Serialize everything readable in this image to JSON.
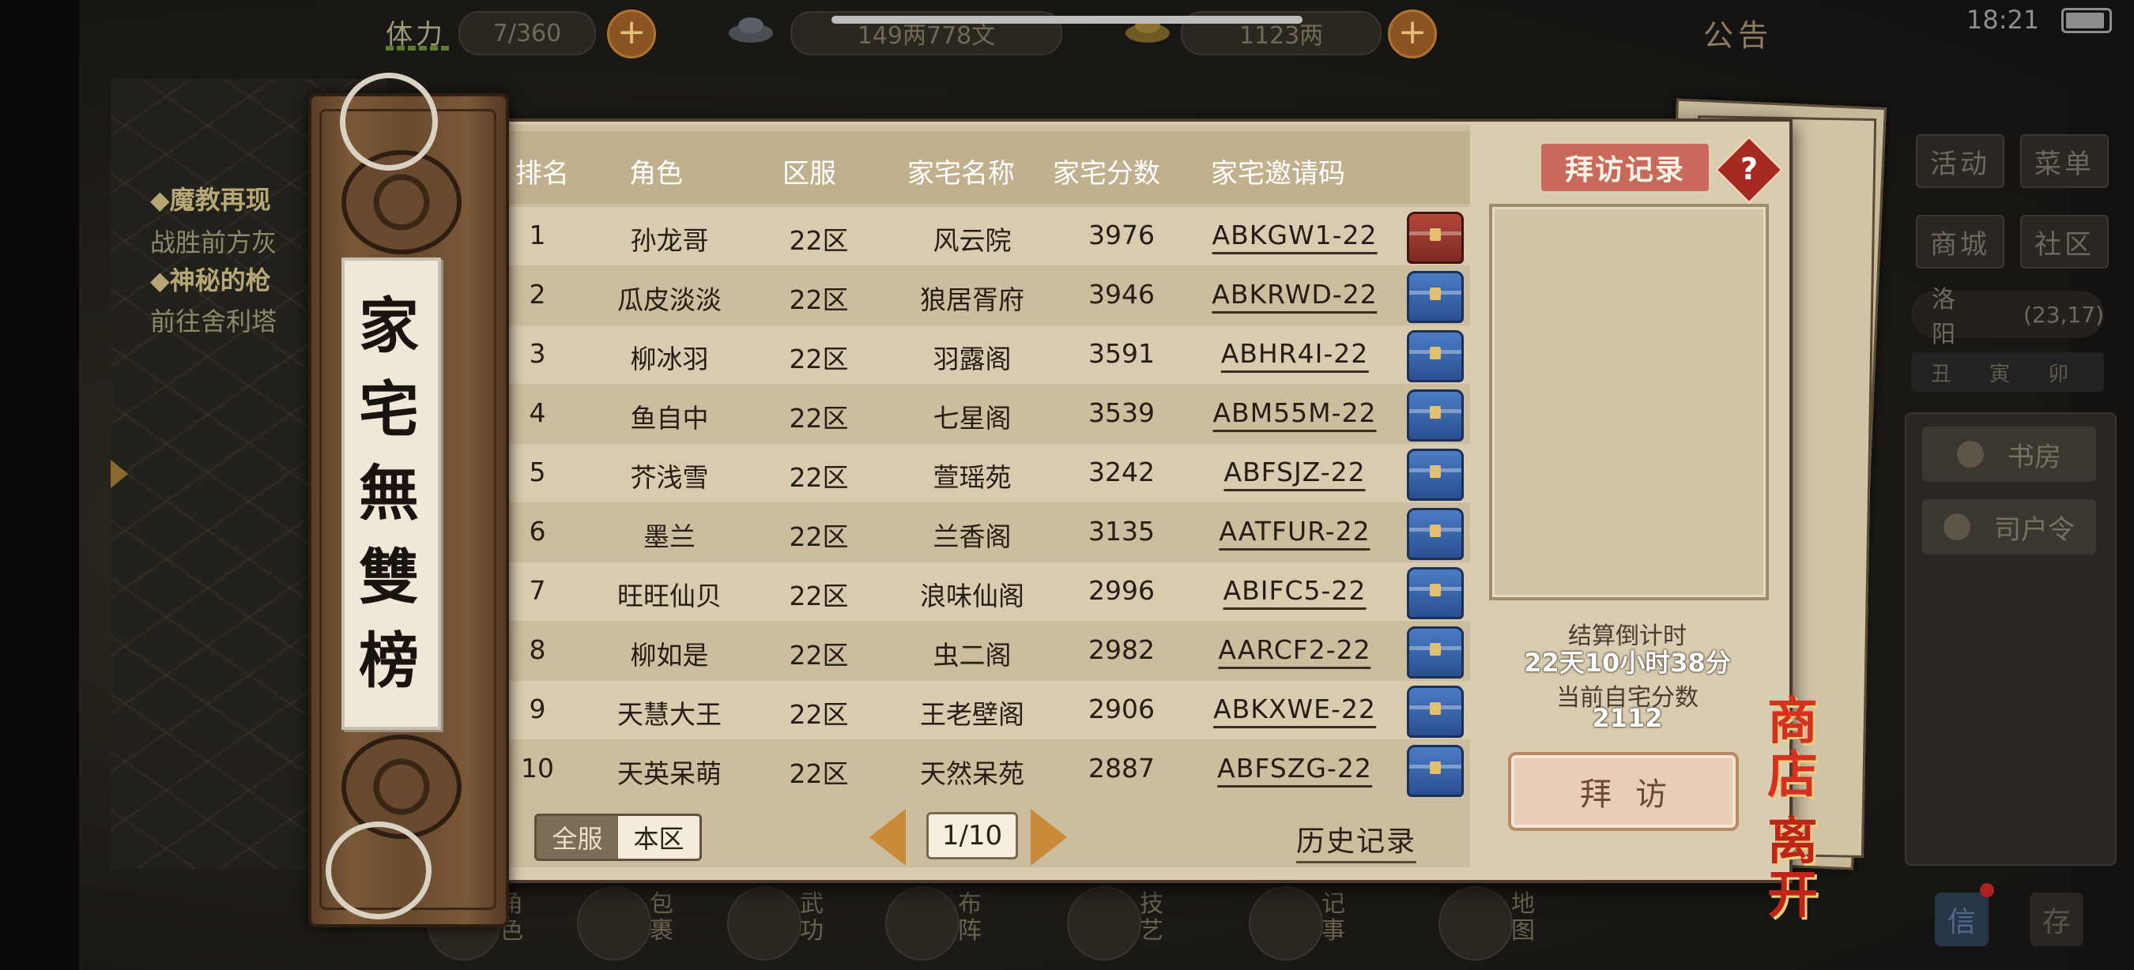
{
  "topbar": {
    "stamina_label": "体力",
    "stamina_value": "7/360",
    "money_value": "149两778文",
    "gold_value": "1123两",
    "notice": "公告",
    "time": "18:21"
  },
  "quests": [
    {
      "title": "◆魔教再现",
      "desc": "战胜前方灰"
    },
    {
      "title": "◆神秘的枪",
      "desc": "前往舍利塔"
    }
  ],
  "side_menu": {
    "activity": "活动",
    "menu": "菜单",
    "mall": "商城",
    "community": "社区",
    "city": "洛阳",
    "coords": "(23,17)",
    "time_strip": "丑 寅 卯",
    "study": "书房",
    "household": "司户令",
    "mail": "信",
    "store": "存"
  },
  "bottom_nav": [
    "角色",
    "包裹",
    "武功",
    "布阵",
    "技艺",
    "记事",
    "地图"
  ],
  "plaque": {
    "title": "家宅無雙榜"
  },
  "table": {
    "headers": [
      "排名",
      "角色",
      "区服",
      "家宅名称",
      "家宅分数",
      "家宅邀请码"
    ],
    "rows": [
      {
        "rank": "1",
        "role": "孙龙哥",
        "server": "22区",
        "home": "风云院",
        "score": "3976",
        "code": "ABKGW1-22",
        "chest": "red"
      },
      {
        "rank": "2",
        "role": "瓜皮淡淡",
        "server": "22区",
        "home": "狼居胥府",
        "score": "3946",
        "code": "ABKRWD-22",
        "chest": "blue"
      },
      {
        "rank": "3",
        "role": "柳冰羽",
        "server": "22区",
        "home": "羽露阁",
        "score": "3591",
        "code": "ABHR4I-22",
        "chest": "blue"
      },
      {
        "rank": "4",
        "role": "鱼自中",
        "server": "22区",
        "home": "七星阁",
        "score": "3539",
        "code": "ABM55M-22",
        "chest": "blue"
      },
      {
        "rank": "5",
        "role": "芥浅雪",
        "server": "22区",
        "home": "萱瑶苑",
        "score": "3242",
        "code": "ABFSJZ-22",
        "chest": "blue"
      },
      {
        "rank": "6",
        "role": "墨兰",
        "server": "22区",
        "home": "兰香阁",
        "score": "3135",
        "code": "AATFUR-22",
        "chest": "blue"
      },
      {
        "rank": "7",
        "role": "旺旺仙贝",
        "server": "22区",
        "home": "浪味仙阁",
        "score": "2996",
        "code": "ABIFC5-22",
        "chest": "blue"
      },
      {
        "rank": "8",
        "role": "柳如是",
        "server": "22区",
        "home": "虫二阁",
        "score": "2982",
        "code": "AARCF2-22",
        "chest": "blue"
      },
      {
        "rank": "9",
        "role": "天慧大王",
        "server": "22区",
        "home": "王老壁阁",
        "score": "2906",
        "code": "ABKXWE-22",
        "chest": "blue"
      },
      {
        "rank": "10",
        "role": "天英呆萌",
        "server": "22区",
        "home": "天然呆苑",
        "score": "2887",
        "code": "ABFSZG-22",
        "chest": "blue"
      }
    ]
  },
  "controls": {
    "all_servers": "全服",
    "this_server": "本区",
    "page": "1/10",
    "history": "历史记录"
  },
  "right_panel": {
    "visit_record": "拜访记录",
    "help": "?",
    "countdown_label": "结算倒计时",
    "countdown_value": "22天10小时38分",
    "score_label": "当前自宅分数",
    "score_value": "2112",
    "visit_button": "拜访"
  },
  "shop_button": "商店",
  "leave_button": "离开",
  "colors": {
    "header_text": "#ffffff",
    "chest_blue": "#3a66ad",
    "chest_red": "#9a3a2f",
    "visit_title_bg": "#c9695c",
    "pager_arrow": "#c98a3a"
  }
}
